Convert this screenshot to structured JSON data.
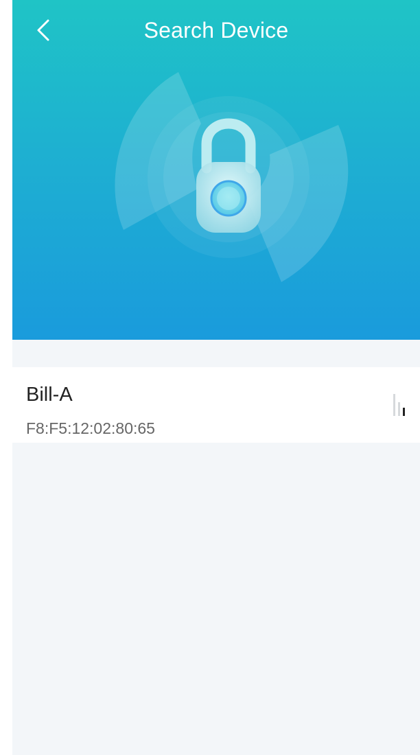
{
  "header": {
    "title": "Search Device",
    "back_icon": "chevron-left-icon",
    "illustration_icon": "bluetooth-padlock-icon",
    "gradient_top": "#1fc4c6",
    "gradient_bottom": "#1a9bdc"
  },
  "devices": [
    {
      "name": "Bill-A",
      "mac": "F8:F5:12:02:80:65",
      "signal_icon": "signal-strength-icon",
      "signal_bars_active": 1,
      "signal_bars_total": 3
    }
  ],
  "colors": {
    "background": "#f3f6f9",
    "row_background": "#ffffff",
    "name_text": "#222222",
    "mac_text": "#666666"
  }
}
